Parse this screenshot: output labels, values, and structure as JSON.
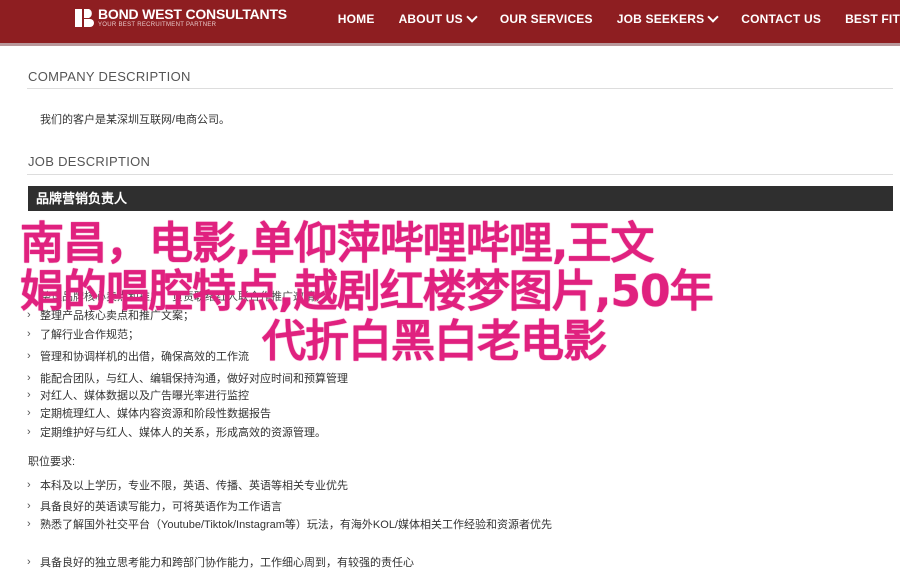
{
  "header": {
    "logo_text": "BOND WEST CONSULTANTS",
    "logo_sub": "YOUR BEST RECRUITMENT PARTNER",
    "nav": [
      "HOME",
      "ABOUT US",
      "OUR SERVICES",
      "JOB SEEKERS",
      "CONTACT US",
      "BEST FIT"
    ]
  },
  "company": {
    "heading": "COMPANY DESCRIPTION",
    "text": "我们的客户是某深圳互联网/电商公司。"
  },
  "job": {
    "heading": "JOB DESCRIPTION",
    "title_bar": "品牌营销负责人",
    "duties_visible": [
      "整理产品核心卖点和推广文案；",
      "整理品牌核心卖点和推广，负责联络红人联合作推广邀请，",
      "了解行业合作规范；",
      "管理和协调样机的出借，确保高效的工作流",
      "能配合团队，与红人、编辑保持沟通，做好对应时间和预算管理",
      "对红人、媒体数据以及广告曝光率进行监控",
      "定期梳理红人、媒体内容资源和阶段性数据报告",
      "定期维护好与红人、媒体人的关系，形成高效的资源管理。"
    ],
    "req_label": "职位要求:",
    "reqs": [
      "本科及以上学历，专业不限，英语、传播、英语等相关专业优先",
      "具备良好的英语读写能力，可将英语作为工作语言",
      "熟悉了解国外社交平台（Youtube/Tiktok/Instagram等）玩法，有海外KOL/媒体相关工作经验和资源者优先",
      "具备良好的独立思考能力和跨部门协作能力，工作细心周到，有较强的责任心"
    ]
  },
  "overlay": {
    "line1": "南昌，电影,单仰萍哔哩哔哩,王文",
    "line2": "娟的唱腔特点,越剧红楼梦图片,50年",
    "line3": "代折白黑白老电影"
  },
  "colors": {
    "header_bg": "#8e1e21",
    "overlay": "#e0217f",
    "title_bar": "#2f2f2f"
  }
}
